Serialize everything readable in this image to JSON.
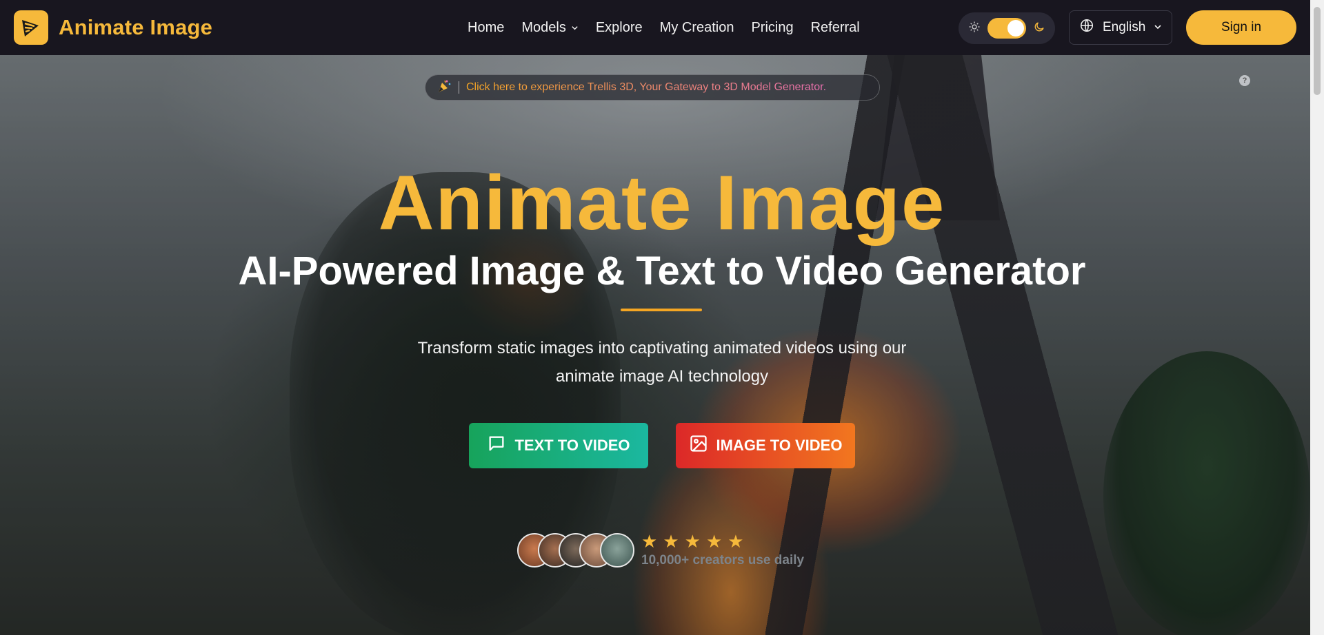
{
  "header": {
    "logo_text": "Animate Image",
    "nav": [
      {
        "label": "Home"
      },
      {
        "label": "Models",
        "has_dropdown": true
      },
      {
        "label": "Explore"
      },
      {
        "label": "My Creation"
      },
      {
        "label": "Pricing"
      },
      {
        "label": "Referral"
      }
    ],
    "theme_toggle": {
      "mode": "dark",
      "icons": [
        "sun-icon",
        "moon-icon"
      ]
    },
    "language": "English",
    "sign_in_label": "Sign in"
  },
  "promo": {
    "text": "Click here to experience Trellis 3D, Your Gateway to 3D Model Generator."
  },
  "hero": {
    "title": "Animate Image",
    "subtitle": "AI-Powered Image & Text to Video Generator",
    "description": "Transform static images into captivating animated videos using our animate image AI technology",
    "buttons": {
      "text_to_video": "TEXT TO VIDEO",
      "image_to_video": "IMAGE TO VIDEO"
    },
    "rating": {
      "stars": 5,
      "creators_text": "10,000+ creators use daily"
    }
  },
  "colors": {
    "brand": "#f6b93b",
    "nav_bg": "#18161f",
    "text_to_video": "#17a35b",
    "image_to_video": "#dc2828"
  }
}
